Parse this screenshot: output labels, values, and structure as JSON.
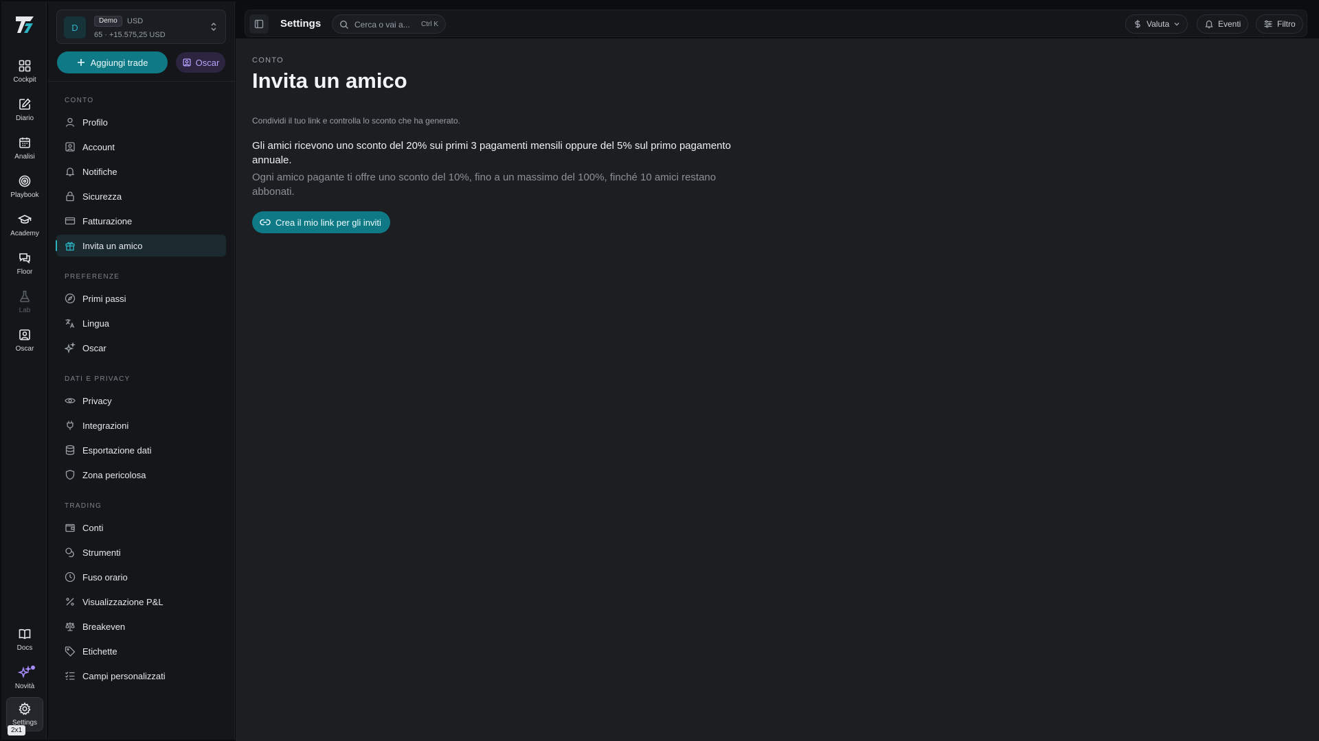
{
  "rail": {
    "logo_icon": "app-logo",
    "items": [
      {
        "label": "Cockpit",
        "icon": "grid-icon"
      },
      {
        "label": "Diario",
        "icon": "edit-icon"
      },
      {
        "label": "Analisi",
        "icon": "calendar-icon"
      },
      {
        "label": "Playbook",
        "icon": "target-icon"
      },
      {
        "label": "Academy",
        "icon": "graduation-cap-icon"
      },
      {
        "label": "Floor",
        "icon": "chat-icon"
      },
      {
        "label": "Lab",
        "icon": "flask-icon"
      },
      {
        "label": "Oscar",
        "icon": "user-square-icon"
      }
    ],
    "bottom": [
      {
        "label": "Docs",
        "icon": "book-icon"
      },
      {
        "label": "Novità",
        "icon": "sparkles-icon"
      },
      {
        "label": "Settings",
        "icon": "gear-icon"
      }
    ],
    "size_chip": "2x1"
  },
  "account": {
    "avatar": "D",
    "badge": "Demo",
    "currency": "USD",
    "stats": "65 · +15.575,25 USD"
  },
  "actions": {
    "add_trade": "Aggiungi trade",
    "oscar": "Oscar"
  },
  "sections": {
    "conto": "CONTO",
    "preferenze": "PREFERENZE",
    "dati": "DATI E PRIVACY",
    "trading": "TRADING"
  },
  "nav": {
    "conto": [
      "Profilo",
      "Account",
      "Notifiche",
      "Sicurezza",
      "Fatturazione",
      "Invita un amico"
    ],
    "preferenze": [
      "Primi passi",
      "Lingua",
      "Oscar"
    ],
    "dati": [
      "Privacy",
      "Integrazioni",
      "Esportazione dati",
      "Zona pericolosa"
    ],
    "trading": [
      "Conti",
      "Strumenti",
      "Fuso orario",
      "Visualizzazione P&L",
      "Breakeven",
      "Etichette",
      "Campi personalizzati"
    ]
  },
  "topbar": {
    "title": "Settings",
    "search_placeholder": "Cerca o vai a...",
    "search_shortcut": "Ctrl K",
    "valuta": "Valuta",
    "eventi": "Eventi",
    "filtro": "Filtro"
  },
  "page": {
    "crumb": "CONTO",
    "title": "Invita un amico",
    "subtitle": "Condividi il tuo link e controlla lo sconto che ha generato.",
    "desc_main": "Gli amici ricevono uno sconto del 20% sui primi 3 pagamenti mensili oppure del 5% sul primo pagamento annuale.",
    "desc_muted": "Ogni amico pagante ti offre uno sconto del 10%, fino a un massimo del 100%, finché 10 amici restano abbonati.",
    "cta": "Crea il mio link per gli inviti"
  },
  "colors": {
    "accent": "#0f7a86",
    "accent_text": "#2bb3c4",
    "oscar_accent": "#b9a5ff",
    "background": "#1c1e22",
    "sidebar": "#141619"
  }
}
